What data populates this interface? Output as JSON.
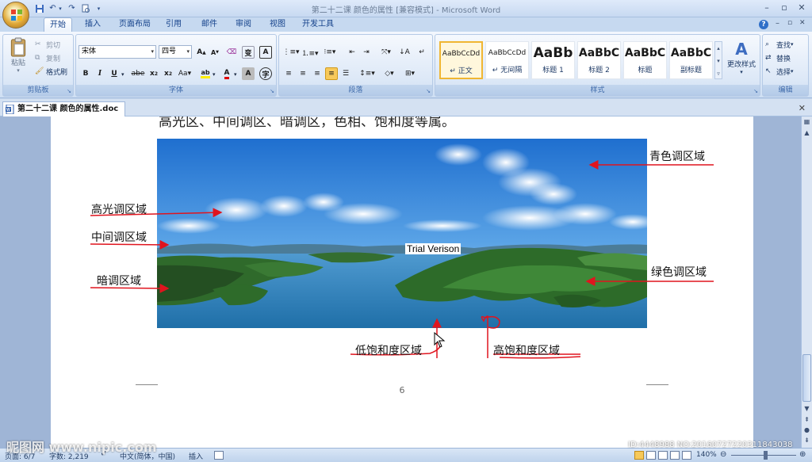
{
  "window": {
    "title": "第二十二课 颜色的属性 [兼容模式] - Microsoft Word"
  },
  "quick_access": {
    "icons": [
      "save-icon",
      "undo-icon",
      "redo-icon",
      "print-preview-icon"
    ]
  },
  "tabs": [
    "开始",
    "插入",
    "页面布局",
    "引用",
    "邮件",
    "审阅",
    "视图",
    "开发工具"
  ],
  "clipboard": {
    "paste": "粘贴",
    "cut": "剪切",
    "copy": "复制",
    "format_painter": "格式刷",
    "label": "剪贴板"
  },
  "font": {
    "family": "宋体",
    "size": "四号",
    "label": "字体",
    "phonetic": "变",
    "border_char": "A",
    "enclose_char": "字"
  },
  "paragraph": {
    "label": "段落"
  },
  "styles": {
    "label": "样式",
    "items": [
      {
        "preview": "AaBbCcDd",
        "name": "↵ 正文"
      },
      {
        "preview": "AaBbCcDd",
        "name": "↵ 无间隔"
      },
      {
        "preview": "AaBb",
        "name": "标题 1"
      },
      {
        "preview": "AaBbC",
        "name": "标题 2"
      },
      {
        "preview": "AaBbC",
        "name": "标题"
      },
      {
        "preview": "AaBbC",
        "name": "副标题"
      }
    ],
    "change_styles": "更改样式"
  },
  "editing": {
    "find": "查找",
    "replace": "替换",
    "select": "选择",
    "label": "编辑"
  },
  "document": {
    "tab_name": "第二十二课 颜色的属性.doc",
    "top_line": "高光区、中间调区、暗调区，色相、饱和度等属。",
    "watermark": "Trial Verison",
    "page_number": "6",
    "labels": {
      "cyan": "青色调区域",
      "highlight": "高光调区域",
      "midtone": "中间调区域",
      "shadow": "暗调区域",
      "green": "绿色调区域",
      "low_sat": "低饱和度区域",
      "high_sat": "高饱和度区域"
    }
  },
  "status": {
    "page": "页面: 6/7",
    "words": "字数: 2,219",
    "lang": "中文(简体，中国)",
    "mode": "插入",
    "zoom": "140%"
  },
  "overlay": {
    "left": "昵图网 www.nipic.com",
    "right": "ID:4448988 NO:20160727220311843038"
  },
  "colors": {
    "accent": "#15428b",
    "annotation": "#e0141e"
  }
}
